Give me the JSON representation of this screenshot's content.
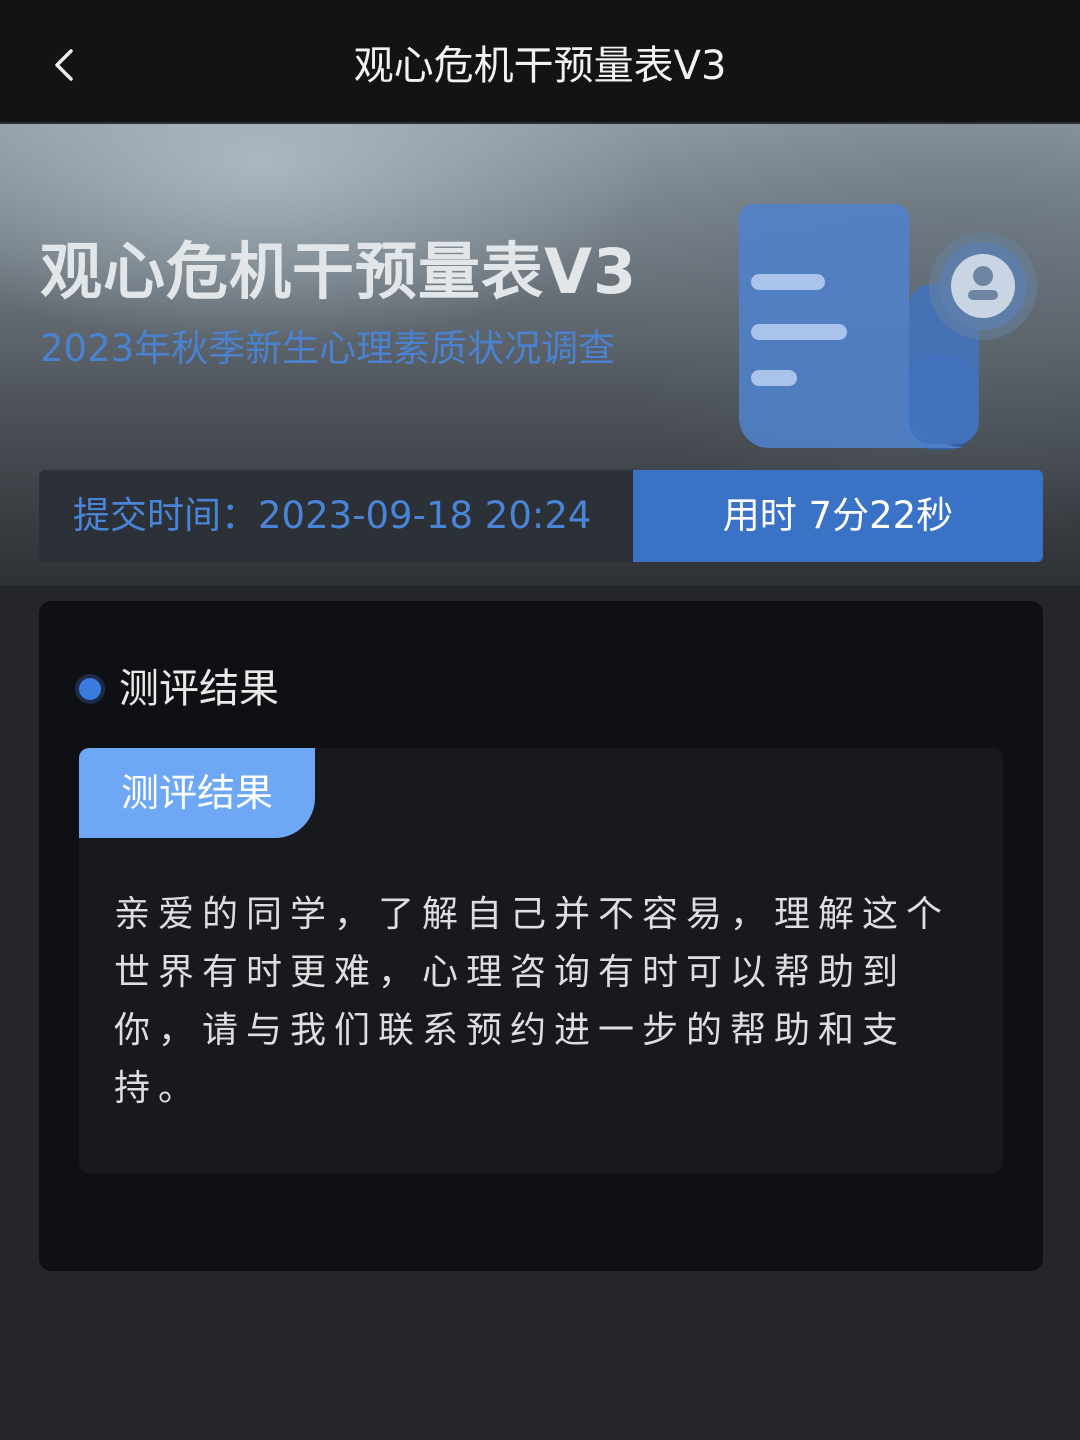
{
  "nav": {
    "title": "观心危机干预量表V3",
    "back_icon": "chevron-left-icon"
  },
  "hero": {
    "title": "观心危机干预量表V3",
    "subtitle": "2023年秋季新生心理素质状况调查",
    "illustration_icon": "document-user-icon"
  },
  "info": {
    "submit_time": "提交时间：2023-09-18 20:24",
    "duration": "用时 7分22秒"
  },
  "result": {
    "section_title": "测评结果",
    "tab_label": "测评结果",
    "text": "亲爱的同学，了解自己并不容易，理解这个世界有时更难，心理咨询有时可以帮助到你，请与我们联系预约进一步的帮助和支持。"
  },
  "colors": {
    "accent": "#3a73c6",
    "accent_light": "#6ea8f4",
    "subtitle_blue": "#4a82cf",
    "card_bg": "#0f1013",
    "page_bg": "#24262b"
  }
}
